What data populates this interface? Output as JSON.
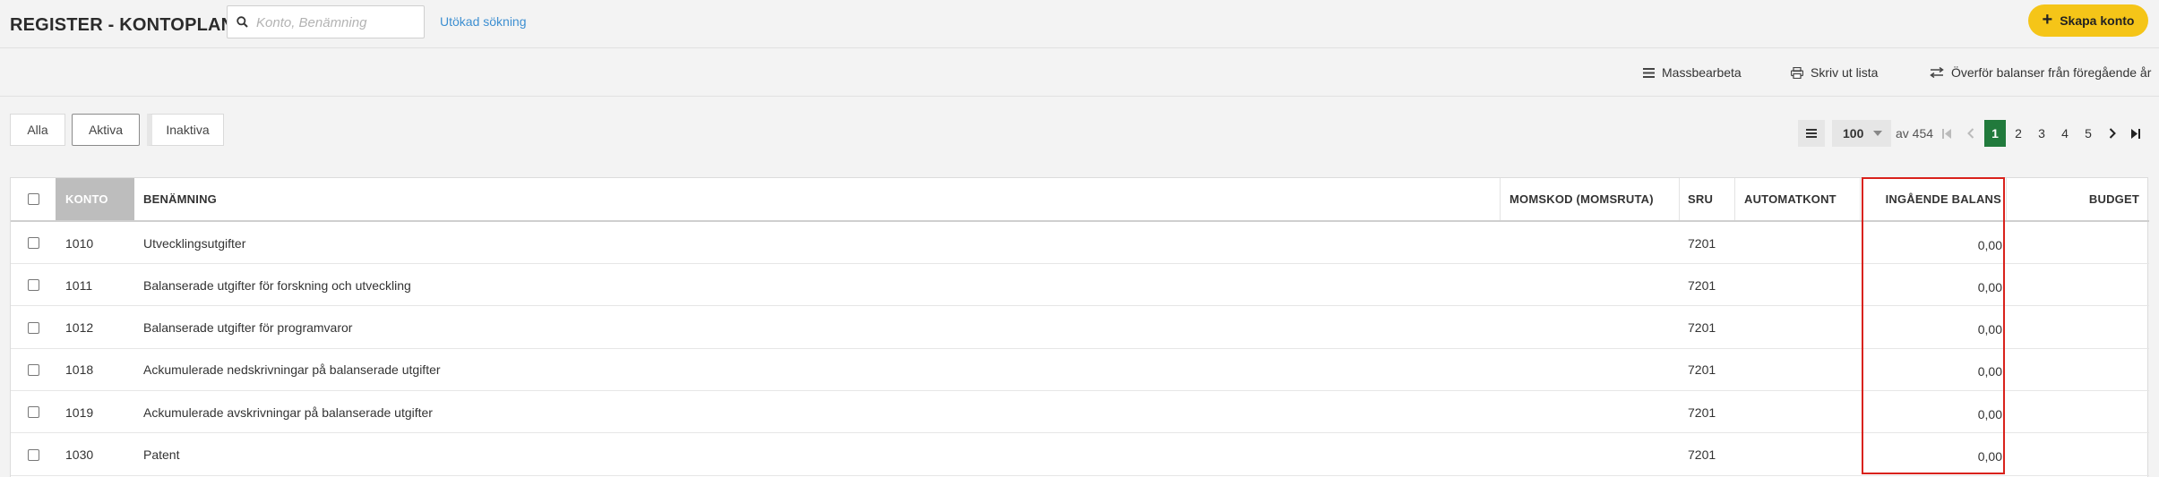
{
  "header": {
    "title": "REGISTER - KONTOPLAN",
    "search_placeholder": "Konto, Benämning",
    "advanced_search": "Utökad sökning",
    "create_button": "Skapa konto"
  },
  "actions": {
    "bulk_edit": "Massbearbeta",
    "print_list": "Skriv ut lista",
    "transfer_balances": "Överför balanser från föregående år"
  },
  "filters": {
    "all": "Alla",
    "active": "Aktiva",
    "inactive": "Inaktiva",
    "selected": "Aktiva"
  },
  "pagination": {
    "page_size": "100",
    "of_label": "av 454",
    "pages": [
      "1",
      "2",
      "3",
      "4",
      "5"
    ],
    "current_page": "1"
  },
  "table": {
    "columns": {
      "konto": "KONTO",
      "benamning": "BENÄMNING",
      "momskod": "MOMSKOD (MOMSRUTA)",
      "sru": "SRU",
      "automatkont": "AUTOMATKONT",
      "ingaende_balans": "INGÅENDE BALANS",
      "budget": "BUDGET"
    },
    "rows": [
      {
        "konto": "1010",
        "benamning": "Utvecklingsutgifter",
        "momskod": "",
        "sru": "7201",
        "automatkont": "",
        "ingaende_balans": "0,00",
        "budget": ""
      },
      {
        "konto": "1011",
        "benamning": "Balanserade utgifter för forskning och utveckling",
        "momskod": "",
        "sru": "7201",
        "automatkont": "",
        "ingaende_balans": "0,00",
        "budget": ""
      },
      {
        "konto": "1012",
        "benamning": "Balanserade utgifter för programvaror",
        "momskod": "",
        "sru": "7201",
        "automatkont": "",
        "ingaende_balans": "0,00",
        "budget": ""
      },
      {
        "konto": "1018",
        "benamning": "Ackumulerade nedskrivningar på balanserade utgifter",
        "momskod": "",
        "sru": "7201",
        "automatkont": "",
        "ingaende_balans": "0,00",
        "budget": ""
      },
      {
        "konto": "1019",
        "benamning": "Ackumulerade avskrivningar på balanserade utgifter",
        "momskod": "",
        "sru": "7201",
        "automatkont": "",
        "ingaende_balans": "0,00",
        "budget": ""
      },
      {
        "konto": "1030",
        "benamning": "Patent",
        "momskod": "",
        "sru": "7201",
        "automatkont": "",
        "ingaende_balans": "0,00",
        "budget": ""
      }
    ]
  },
  "colors": {
    "accent_yellow": "#f5c518",
    "current_page_green": "#217a3c",
    "link_blue": "#3d8fd1",
    "highlight_red": "#d9221c"
  },
  "icons": {
    "search": "search-icon",
    "create": "plus-icon",
    "bulk_edit": "list-icon",
    "print": "printer-icon",
    "transfer": "transfer-arrows-icon",
    "menu": "menu-icon",
    "first": "first-page-icon",
    "prev": "chevron-left-icon",
    "next": "chevron-right-icon",
    "last": "last-page-icon"
  }
}
